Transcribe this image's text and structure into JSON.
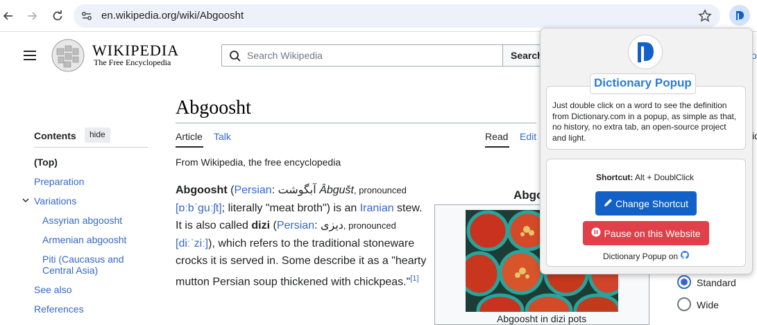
{
  "browser": {
    "url": "en.wikipedia.org/wiki/Abgoosht"
  },
  "wiki": {
    "wordmark": "WIKIPEDIA",
    "tagline": "The Free Encyclopedia",
    "search_placeholder": "Search Wikipedia",
    "search_button": "Search"
  },
  "toc": {
    "title": "Contents",
    "hide_label": "hide",
    "items": [
      {
        "label": "(Top)"
      },
      {
        "label": "Preparation"
      },
      {
        "label": "Variations"
      },
      {
        "label": "Assyrian abgoosht"
      },
      {
        "label": "Armenian abgoosht"
      },
      {
        "label": "Piti (Caucasus and"
      },
      {
        "label": "Central Asia)"
      },
      {
        "label": "See also"
      },
      {
        "label": "References"
      }
    ]
  },
  "article": {
    "title": "Abgoosht",
    "tabs": {
      "article": "Article",
      "talk": "Talk",
      "read": "Read",
      "edit": "Edit"
    },
    "from": "From Wikipedia, the free encyclopedia",
    "para": {
      "w1": "Abgoosht",
      "w2": " (",
      "w3": "Persian",
      "w4": ": آبگوشت ",
      "w5": "Âbgušt",
      "w6": ", pronounced",
      "w7": "[ɒːbˈɡuːʃt]",
      "w8": "; literally \"meat broth\") is an ",
      "w9": "Iranian",
      "w10": " stew.",
      "w11": "It is also called ",
      "w12": "dizi",
      "w13": " (",
      "w14": "Persian",
      "w15": ": دیزی",
      "w16": ", pronounced",
      "w17": "[diːˈziː]",
      "w18": "), which refers to the traditional stoneware crocks it is served in. Some describe it as a \"hearty mutton Persian soup thickened with chickpeas.\"",
      "ref": "[1]"
    },
    "infobox_title": "Abgo",
    "infobox_caption": "Abgoosht in dizi pots"
  },
  "appearance": {
    "right_cut_1": "id",
    "right_cut_2": "o",
    "options": [
      {
        "label": "Standard",
        "selected": true
      },
      {
        "label": "Wide",
        "selected": false
      }
    ]
  },
  "popup": {
    "title": "Dictionary Popup",
    "description": "Just double click on a word to see the definition from Dictionary.com in a popup, as simple as that, no history, no extra tab, an open-source project and light.",
    "shortcut_label": "Shortcut:",
    "shortcut_value": " Alt + DoublClick",
    "change_button": "Change Shortcut",
    "pause_button": "Pause on this Website",
    "footer": "Dictionary Popup on",
    "colors": {
      "primary": "#1261c9",
      "danger": "#e0404a",
      "title": "#2a7ae2"
    }
  }
}
